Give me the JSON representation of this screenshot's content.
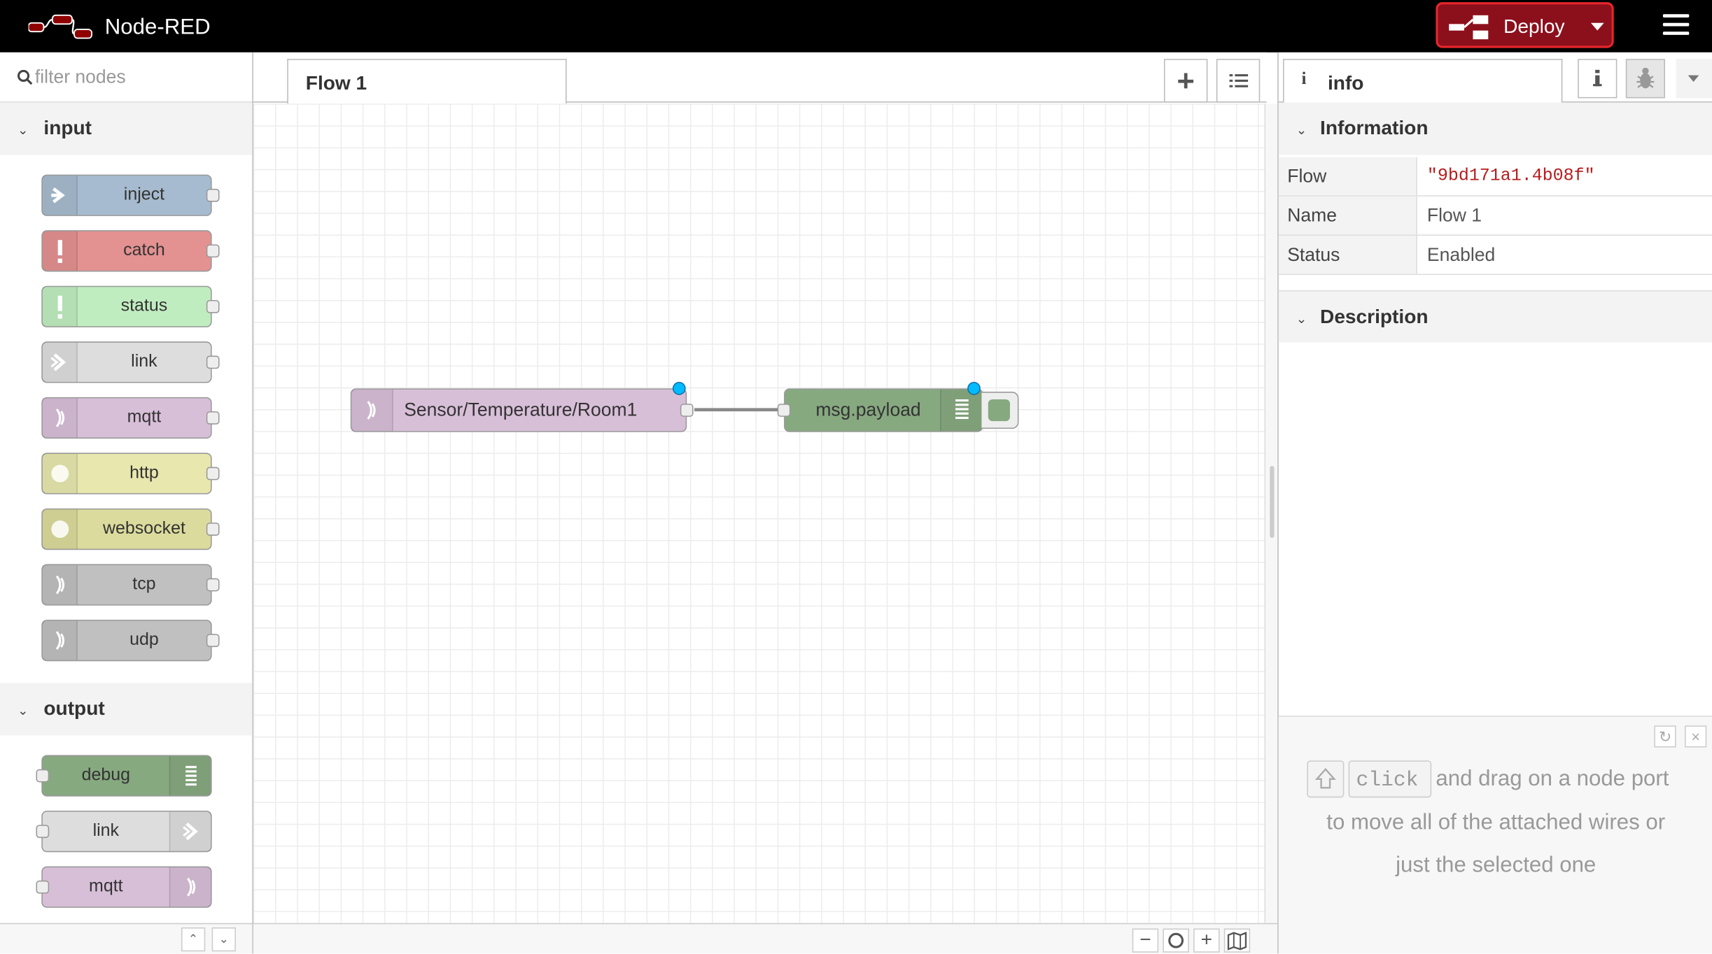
{
  "header": {
    "title": "Node-RED",
    "deploy_label": "Deploy"
  },
  "palette": {
    "search_placeholder": "filter nodes",
    "categories": [
      {
        "name": "input",
        "nodes": [
          {
            "label": "inject",
            "color": "#a6bbcf",
            "icon": "arrow-in-icon"
          },
          {
            "label": "catch",
            "color": "#e49191",
            "icon": "alert-icon"
          },
          {
            "label": "status",
            "color": "#c0edc0",
            "icon": "alert-icon"
          },
          {
            "label": "link",
            "color": "#dddddd",
            "icon": "link-in-icon"
          },
          {
            "label": "mqtt",
            "color": "#d8bfd8",
            "icon": "bridge-icon"
          },
          {
            "label": "http",
            "color": "#e7e7ae",
            "icon": "globe-icon"
          },
          {
            "label": "websocket",
            "color": "#dbdb9d",
            "icon": "globe-icon"
          },
          {
            "label": "tcp",
            "color": "#c0c0c0",
            "icon": "bridge-icon"
          },
          {
            "label": "udp",
            "color": "#c0c0c0",
            "icon": "bridge-icon"
          }
        ]
      },
      {
        "name": "output",
        "nodes": [
          {
            "label": "debug",
            "color": "#87a980",
            "icon": "debug-icon"
          },
          {
            "label": "link",
            "color": "#dddddd",
            "icon": "link-out-icon"
          },
          {
            "label": "mqtt",
            "color": "#d8bfd8",
            "icon": "bridge-icon"
          }
        ]
      }
    ]
  },
  "workspace": {
    "tabs": [
      {
        "label": "Flow 1"
      }
    ],
    "nodes": [
      {
        "label": "Sensor/Temperature/Room1",
        "type": "mqtt in",
        "color": "#d8bfd8"
      },
      {
        "label": "msg.payload",
        "type": "debug",
        "color": "#87a980"
      }
    ]
  },
  "sidebar": {
    "tab_label": "info",
    "tab_icon": "i",
    "information_title": "Information",
    "rows": [
      {
        "key": "Flow",
        "value": "\"9bd171a1.4b08f\""
      },
      {
        "key": "Name",
        "value": "Flow 1"
      },
      {
        "key": "Status",
        "value": "Enabled"
      }
    ],
    "description_title": "Description",
    "tip": {
      "key_label": "click",
      "line1": "and drag on a node port",
      "line2": "to move all of the attached wires or",
      "line3": "just the selected one"
    }
  },
  "colors": {
    "deploy_bg": "#8c101c",
    "deploy_border": "#e8262b",
    "header_bg": "#000000",
    "changed_marker": "#00bcff"
  }
}
